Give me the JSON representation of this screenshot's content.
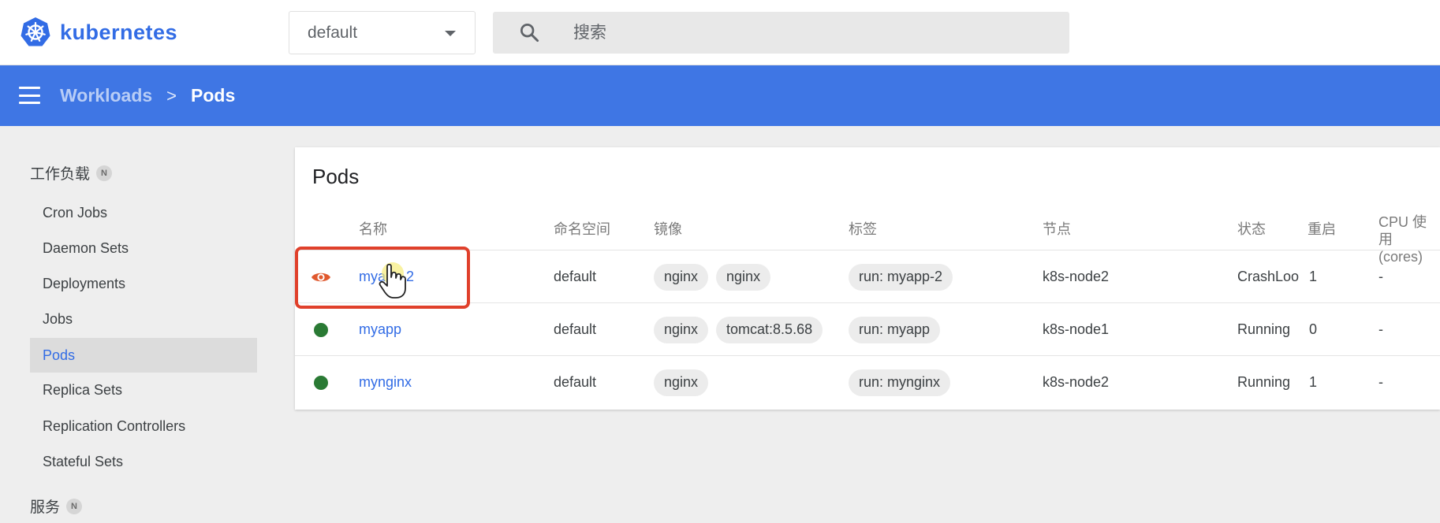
{
  "app": {
    "brand_name": "kubernetes",
    "brand_color": "#326ce5"
  },
  "namespace_select": {
    "value": "default"
  },
  "search": {
    "placeholder": "搜索"
  },
  "navbar": {
    "color": "#3f76e4",
    "breadcrumb": {
      "parent": "Workloads",
      "separator": ">",
      "current": "Pods"
    }
  },
  "sidebar": {
    "category_workloads": "工作负载",
    "category_workloads_badge": "N",
    "items": [
      {
        "label": "Cron Jobs"
      },
      {
        "label": "Daemon Sets"
      },
      {
        "label": "Deployments"
      },
      {
        "label": "Jobs"
      },
      {
        "label": "Pods"
      },
      {
        "label": "Replica Sets"
      },
      {
        "label": "Replication Controllers"
      },
      {
        "label": "Stateful Sets"
      }
    ],
    "active_item": "Pods",
    "category_services": "服务",
    "category_services_badge": "N"
  },
  "pods_card": {
    "title": "Pods",
    "columns": {
      "name": "名称",
      "namespace": "命名空间",
      "images": "镜像",
      "labels": "标签",
      "node": "节点",
      "status": "状态",
      "restarts": "重启",
      "cpu_line1": "CPU 使用",
      "cpu_line2": "(cores)"
    },
    "rows": [
      {
        "status_icon": "eye-icon",
        "status_icon_color": "#e0592e",
        "name": "myapp-2",
        "namespace": "default",
        "images": [
          "nginx",
          "nginx"
        ],
        "label": "run: myapp-2",
        "node": "k8s-node2",
        "status": "CrashLoo",
        "restarts": "1",
        "cpu": "-"
      },
      {
        "status_icon": "running-dot-icon",
        "status_icon_color": "#2a7a34",
        "name": "myapp",
        "namespace": "default",
        "images": [
          "nginx",
          "tomcat:8.5.68"
        ],
        "label": "run: myapp",
        "node": "k8s-node1",
        "status": "Running",
        "restarts": "0",
        "cpu": "-"
      },
      {
        "status_icon": "running-dot-icon",
        "status_icon_color": "#2a7a34",
        "name": "mynginx",
        "namespace": "default",
        "images": [
          "nginx"
        ],
        "label": "run: mynginx",
        "node": "k8s-node2",
        "status": "Running",
        "restarts": "1",
        "cpu": "-"
      }
    ]
  },
  "annotation": {
    "highlight_color": "#e0402b"
  }
}
